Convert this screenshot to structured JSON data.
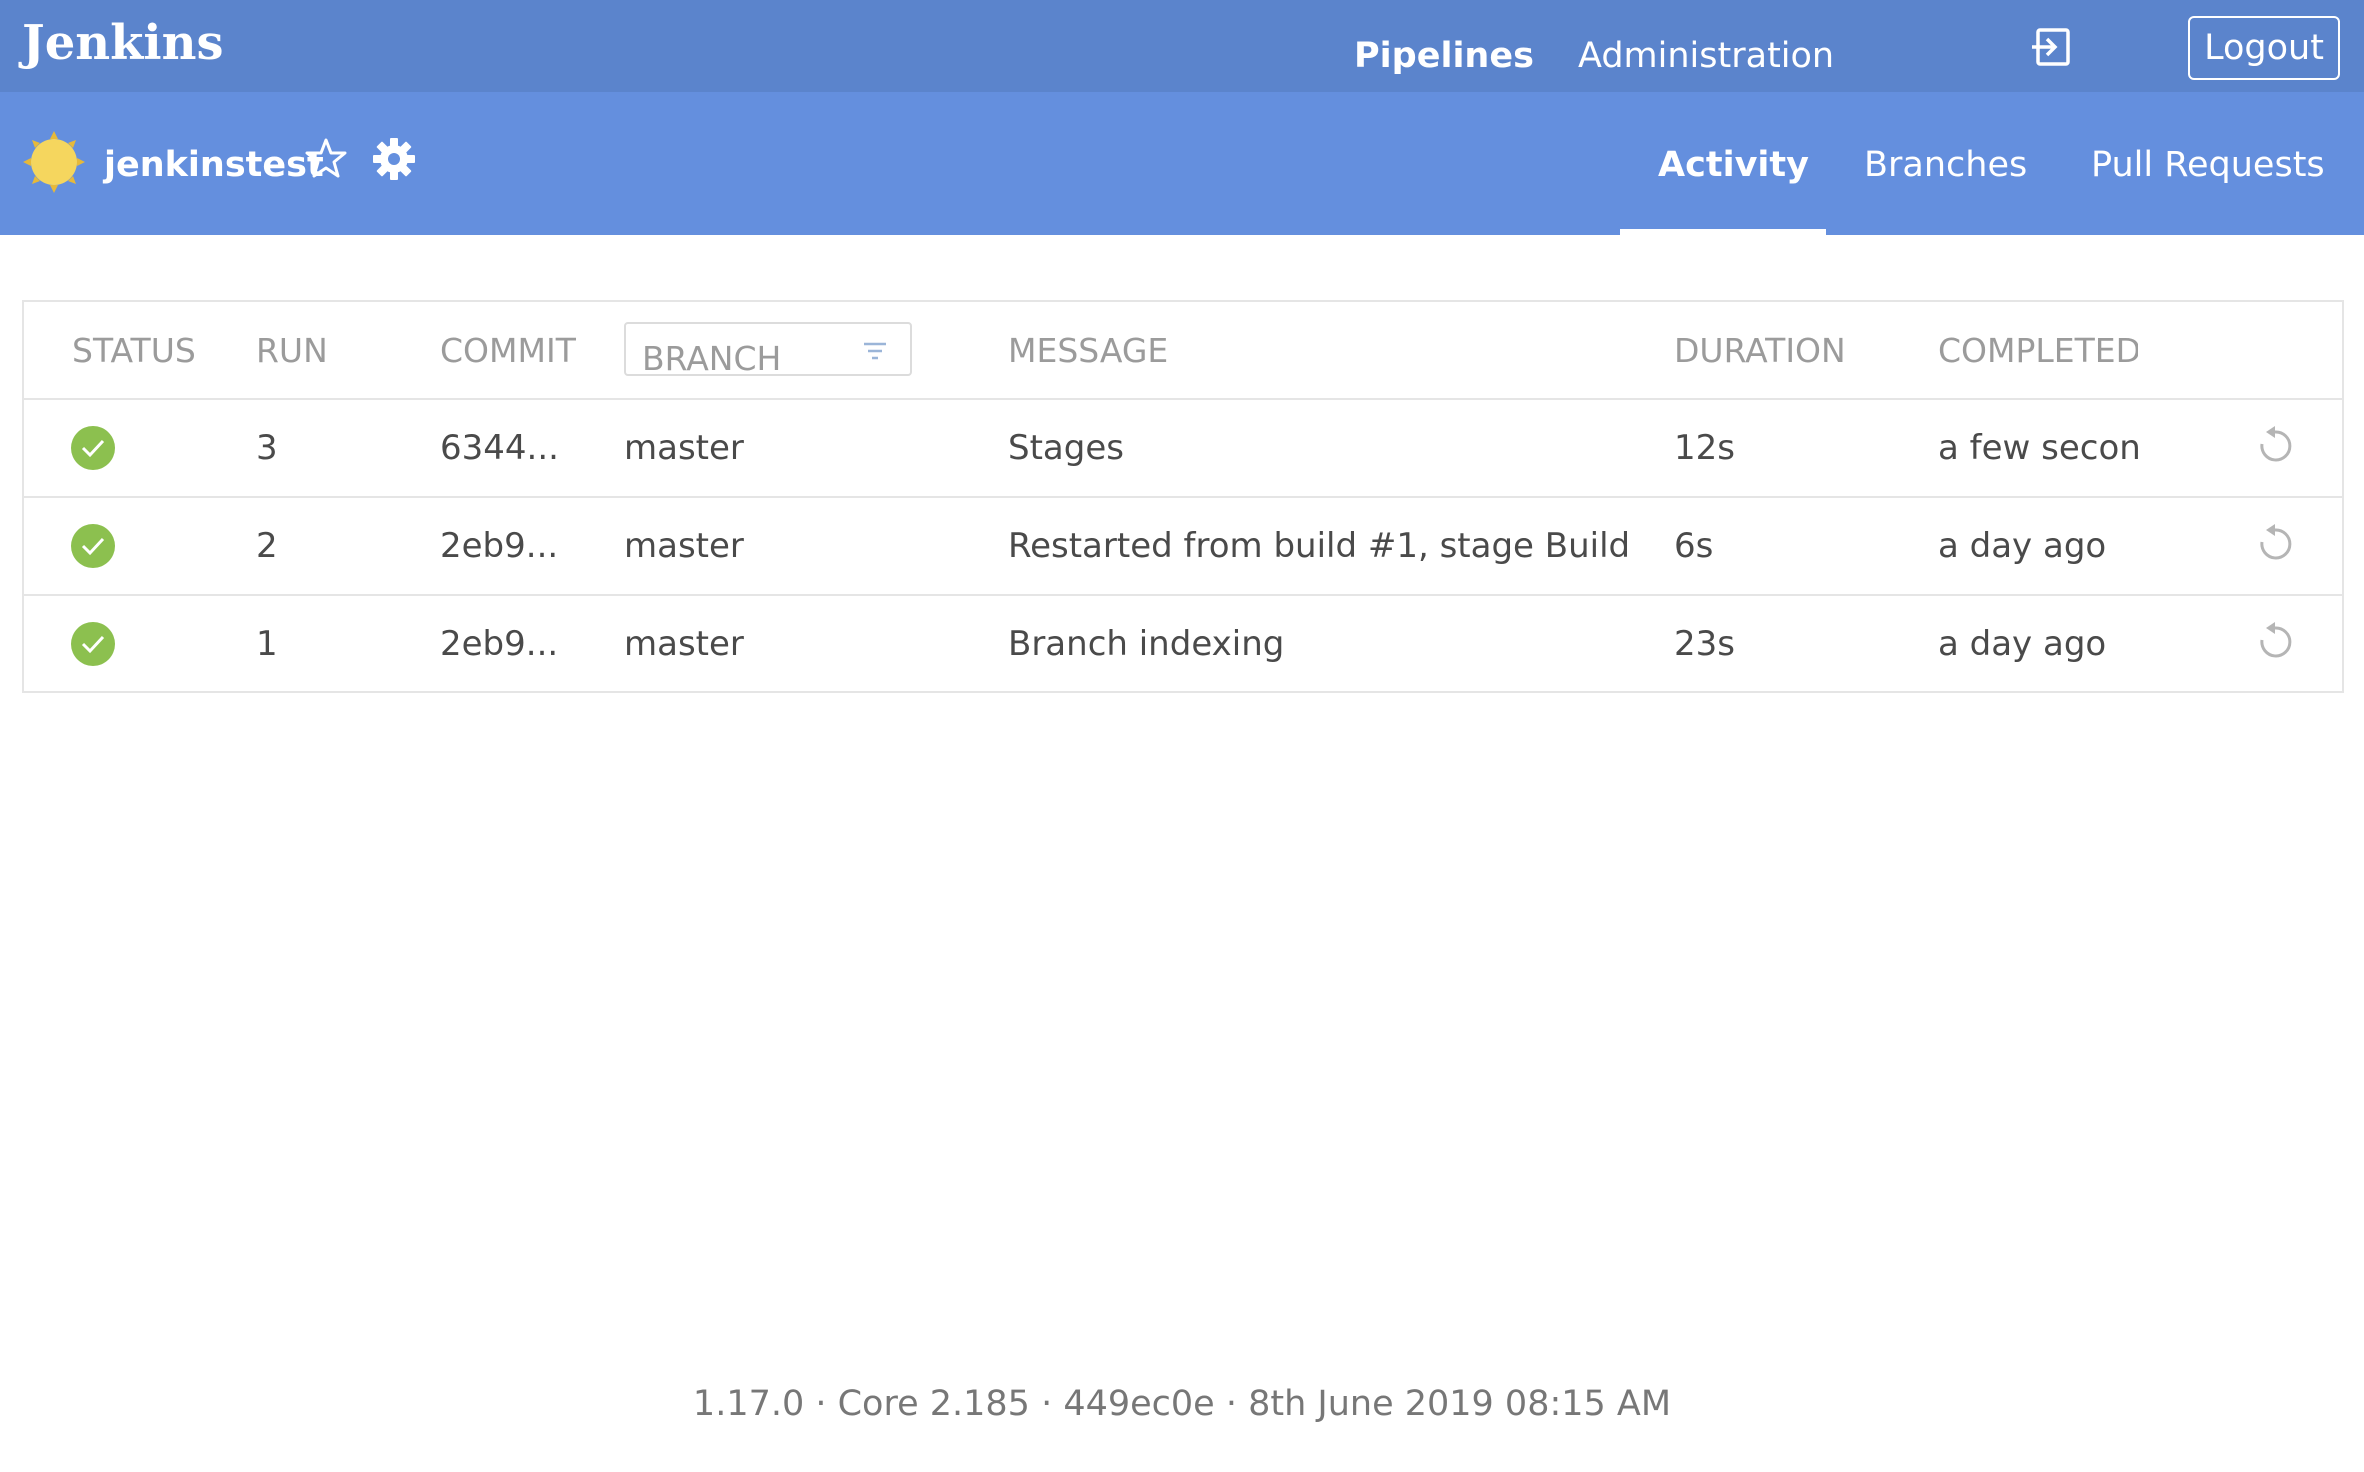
{
  "app": {
    "logo": "Jenkins"
  },
  "topnav": {
    "pipelines": "Pipelines",
    "administration": "Administration",
    "logout": "Logout"
  },
  "pipeline": {
    "name": "jenkinstest",
    "weather": "sunny-icon"
  },
  "tabs": {
    "activity": "Activity",
    "branches": "Branches",
    "pull_requests": "Pull Requests",
    "active": "Activity"
  },
  "table": {
    "headers": {
      "status": "STATUS",
      "run": "RUN",
      "commit": "COMMIT",
      "branch": "BRANCH",
      "message": "MESSAGE",
      "duration": "DURATION",
      "completed": "COMPLETED"
    },
    "rows": [
      {
        "status": "success",
        "run": "3",
        "commit": "6344...",
        "branch": "master",
        "message": "Stages",
        "duration": "12s",
        "completed": "a few seconds ago"
      },
      {
        "status": "success",
        "run": "2",
        "commit": "2eb9...",
        "branch": "master",
        "message": "Restarted from build #1, stage Build",
        "duration": "6s",
        "completed": "a day ago"
      },
      {
        "status": "success",
        "run": "1",
        "commit": "2eb9...",
        "branch": "master",
        "message": "Branch indexing",
        "duration": "23s",
        "completed": "a day ago"
      }
    ]
  },
  "footer": {
    "text": "1.17.0 · Core 2.185 · 449ec0e · 8th June 2019 08:15 AM"
  },
  "colors": {
    "topbar": "#5b84cc",
    "subbar": "#648fde",
    "success": "#8cc04f",
    "weather": "#f5d65e"
  }
}
